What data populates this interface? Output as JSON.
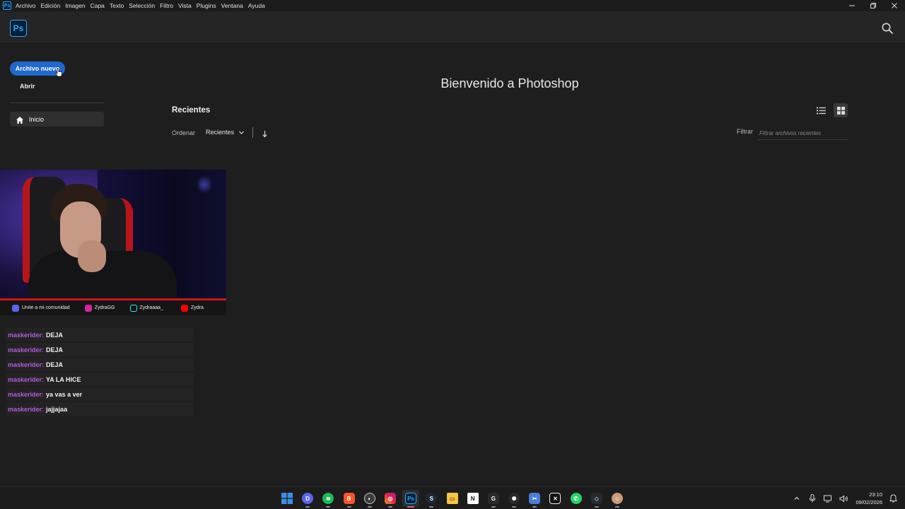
{
  "menubar": {
    "app_icon": "Ps",
    "items": [
      "Archivo",
      "Edición",
      "Imagen",
      "Capa",
      "Texto",
      "Selección",
      "Filtro",
      "Vista",
      "Plugins",
      "Ventana",
      "Ayuda"
    ],
    "window_controls": [
      "minimize-icon",
      "restore-icon",
      "close-icon"
    ]
  },
  "header": {
    "logo": "Ps",
    "search_icon": "search-icon"
  },
  "sidebar": {
    "new_file_label": "Archivo nuevo",
    "open_label": "Abrir",
    "nav": [
      {
        "label": "Inicio",
        "icon": "home-icon"
      }
    ]
  },
  "main": {
    "welcome": "Bienvenido a Photoshop",
    "recents_title": "Recientes",
    "sort_label": "Ordenar",
    "sort_value": "Recientes",
    "filter_label": "Filtrar",
    "filter_placeholder": "Filtrar archivos recientes",
    "view_modes": [
      "list-view-icon",
      "grid-view-icon"
    ],
    "active_view": "grid"
  },
  "stream_overlay": {
    "socials": [
      {
        "icon": "discord-icon",
        "label": "Unite a mi comunidad",
        "color": "#5865f2"
      },
      {
        "icon": "instagram-icon",
        "label": "ZydraGG",
        "color": "#d6249f"
      },
      {
        "icon": "tiktok-icon",
        "label": "Zydraaaa_",
        "color": "#25f4ee"
      },
      {
        "icon": "youtube-icon",
        "label": "Zydra",
        "color": "#ff0000"
      }
    ],
    "chat": [
      {
        "user": "maskerider",
        "message": "DEJA"
      },
      {
        "user": "maskerider",
        "message": "DEJA"
      },
      {
        "user": "maskerider",
        "message": "DEJA"
      },
      {
        "user": "maskerider",
        "message": "YA LA HICE"
      },
      {
        "user": "maskerider",
        "message": "ya vas a ver"
      },
      {
        "user": "maskerider",
        "message": "jajjajaa"
      }
    ],
    "chat_user_color": "#b05be0"
  },
  "taskbar": {
    "apps": [
      {
        "name": "windows-start",
        "color": "#3a8ee6"
      },
      {
        "name": "discord",
        "color": "#5865f2"
      },
      {
        "name": "spotify",
        "color": "#1db954"
      },
      {
        "name": "brave",
        "color": "#fb542b"
      },
      {
        "name": "obs-studio",
        "color": "#3c3c3c"
      },
      {
        "name": "instagram",
        "color": "#d6249f"
      },
      {
        "name": "photoshop",
        "color": "#001e36",
        "active": true
      },
      {
        "name": "steam",
        "color": "#1b2838"
      },
      {
        "name": "file-explorer",
        "color": "#f4c542"
      },
      {
        "name": "notion",
        "color": "#ffffff"
      },
      {
        "name": "g-hub",
        "color": "#2a2a2a"
      },
      {
        "name": "steelseries",
        "color": "#2a2a2a"
      },
      {
        "name": "snipping-tool",
        "color": "#4a7ed8"
      },
      {
        "name": "capcut",
        "color": "#111111"
      },
      {
        "name": "whatsapp",
        "color": "#25d366"
      },
      {
        "name": "app-launcher",
        "color": "#2a2a2a"
      },
      {
        "name": "browser-profile",
        "color": "#c99b7a"
      }
    ],
    "time": "23:10",
    "date": "09/02/2026"
  },
  "colors": {
    "accent": "#2068cc",
    "background": "#1e1e1e",
    "header": "#252525"
  }
}
